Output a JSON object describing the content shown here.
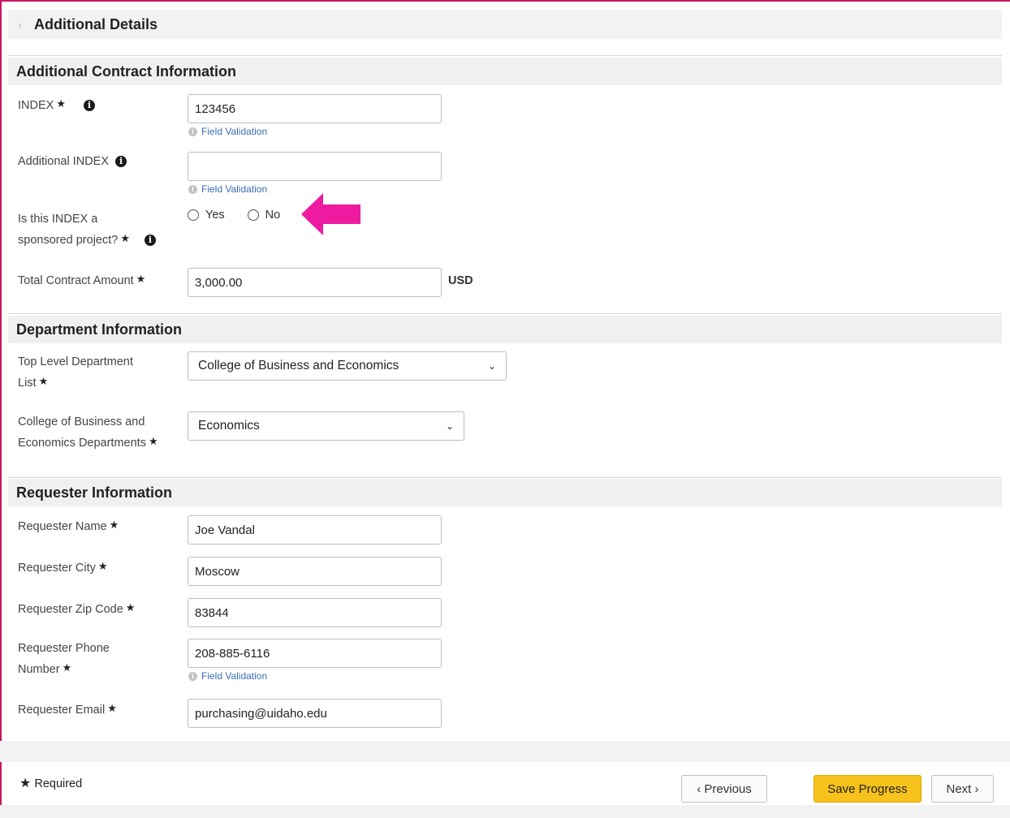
{
  "accordion": {
    "chevron": "›",
    "title": "Additional Details"
  },
  "sections": {
    "contract": "Additional Contract Information",
    "department": "Department Information",
    "requester": "Requester Information"
  },
  "fields": {
    "index": {
      "label": "INDEX",
      "value": "123456"
    },
    "additional_index": {
      "label": "Additional INDEX",
      "value": ""
    },
    "sponsored": {
      "label_line1": "Is this INDEX a",
      "label_line2": "sponsored project?",
      "options": [
        "Yes",
        "No"
      ]
    },
    "total_amount": {
      "label": "Total Contract Amount",
      "value": "3,000.00",
      "currency": "USD"
    },
    "top_dept": {
      "label_line1": "Top Level Department",
      "label_line2": "List",
      "value": "College of Business and Economics"
    },
    "college_dept": {
      "label_line1": "College of Business and",
      "label_line2": "Economics Departments",
      "value": "Economics"
    },
    "req_name": {
      "label": "Requester Name",
      "value": "Joe Vandal"
    },
    "req_city": {
      "label": "Requester City",
      "value": "Moscow"
    },
    "req_zip": {
      "label": "Requester Zip Code",
      "value": "83844"
    },
    "req_phone": {
      "label_line1": "Requester Phone",
      "label_line2": "Number",
      "value": "208-885-6116"
    },
    "req_email": {
      "label": "Requester Email",
      "value": "purchasing@uidaho.edu"
    }
  },
  "validation_text": "Field Validation",
  "star": "★",
  "info_glyph": "i",
  "validation_glyph": "i",
  "caret": "⌄",
  "footer": {
    "required": "Required",
    "previous": "‹ Previous",
    "save": "Save Progress",
    "next": "Next ›"
  },
  "colors": {
    "frame": "#c8175d",
    "annotation_arrow": "#ee1aa0",
    "save_button": "#f6c21b",
    "link": "#3b6fb6"
  },
  "icons": {
    "info": "info-circle-icon",
    "arrow": "pink-arrow-annotation",
    "caret": "chevron-down-icon"
  }
}
